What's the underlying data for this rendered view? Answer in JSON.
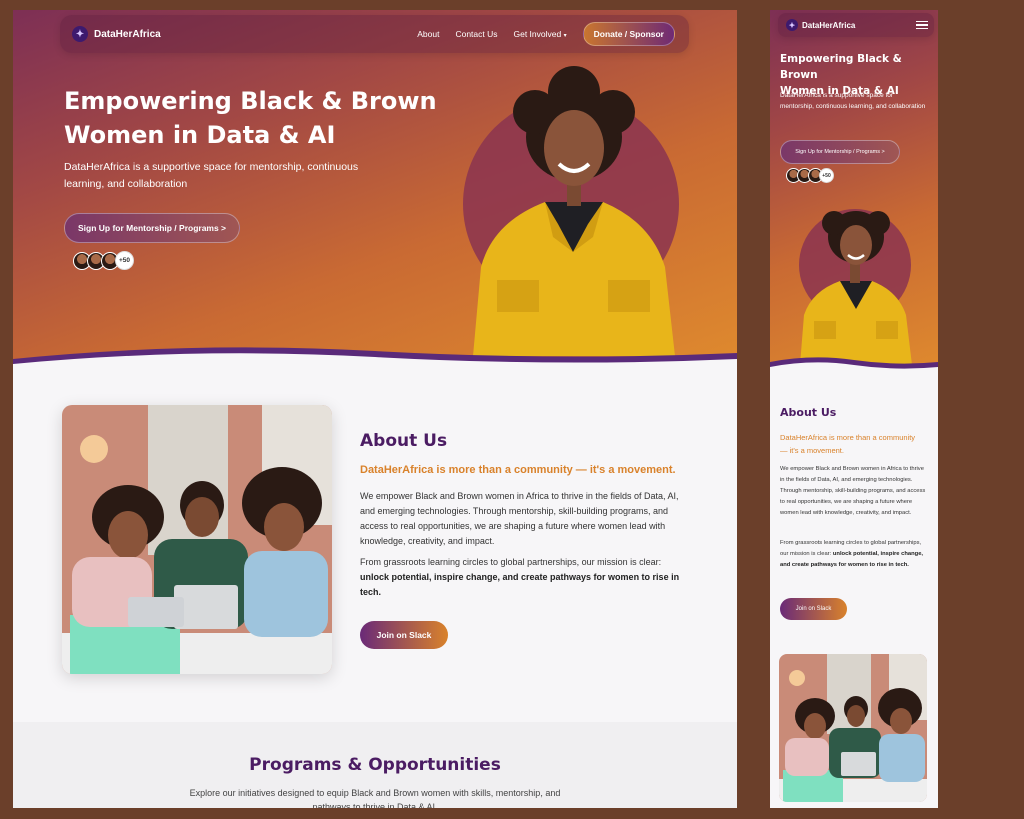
{
  "brand": {
    "name": "DataHerAfrica",
    "icon": "sparkle-logo-icon"
  },
  "nav": {
    "about": "About",
    "contact": "Contact Us",
    "get_involved": "Get Involved",
    "donate": "Donate / Sponsor",
    "menu_icon": "hamburger-menu-icon"
  },
  "hero": {
    "title_line1": "Empowering Black & Brown",
    "title_line2": "Women in Data & AI",
    "subtitle": "DataHerAfrica is a supportive space for mentorship, continuous learning, and collaboration",
    "cta": "Sign Up for Mentorship / Programs >",
    "avatar_count": "+50"
  },
  "about": {
    "title": "About Us",
    "tagline": "DataHerAfrica is more than a community — it's a movement.",
    "p1": "We empower Black and Brown women in Africa to thrive in the fields of Data, AI, and emerging technologies. Through mentorship, skill-building programs, and access to real opportunities, we are shaping a future where women lead with knowledge, creativity, and impact.",
    "p2_start": "From grassroots learning circles to global partnerships, our mission is clear:",
    "p2_bold": "unlock potential, inspire change, and create pathways for women to rise in tech.",
    "cta": "Join on Slack"
  },
  "programs": {
    "title": "Programs & Opportunities",
    "subtitle": "Explore our initiatives designed to equip Black and Brown women with skills, mentorship, and pathways to thrive in Data & AI."
  },
  "colors": {
    "page_bg": "#6b3f2a",
    "hero_start": "#7d2f55",
    "hero_end": "#df8a2e",
    "heading_purple": "#4b1c63",
    "accent_orange": "#d9822b"
  }
}
